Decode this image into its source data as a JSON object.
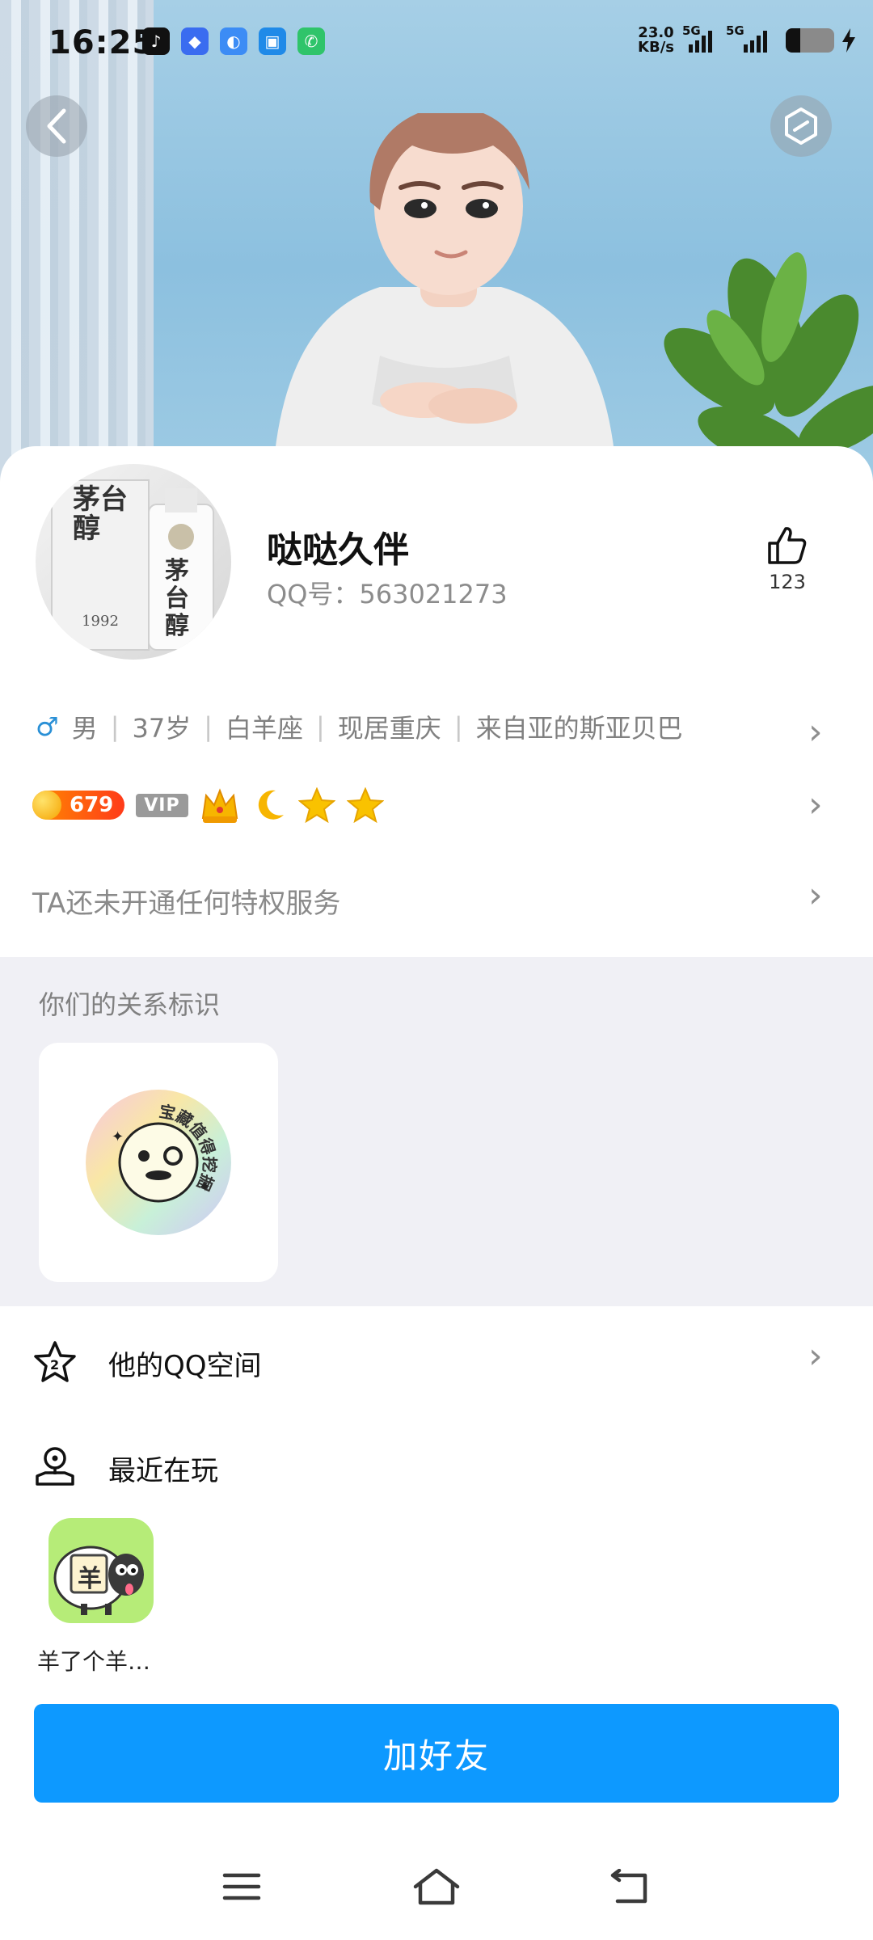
{
  "status_bar": {
    "time": "16:25",
    "net_speed_value": "23.0",
    "net_speed_unit": "KB/s",
    "sim1_label": "5G",
    "sim2_label": "5G",
    "notification_icons": [
      "tiktok-icon",
      "app-icon-blue-diamond",
      "app-icon-blue-oval",
      "app-icon-blue-square",
      "phone-call-icon"
    ]
  },
  "header": {
    "back_icon": "chevron-left-icon",
    "action_icon": "hexagon-settings-icon"
  },
  "profile": {
    "nickname": "哒哒久伴",
    "qq_label": "QQ号：563021273",
    "like_count": "123",
    "avatar_text_1": "茅台醇",
    "avatar_text_2": "茅台醇",
    "avatar_year": "1992"
  },
  "info": {
    "gender": "男",
    "age": "37岁",
    "zodiac": "白羊座",
    "residence": "现居重庆",
    "hometown": "来自亚的斯亚贝巴"
  },
  "badges": {
    "level_number": "679",
    "vip_label": "VIP",
    "level_icons": [
      "crown-icon",
      "moon-icon",
      "star-icon",
      "star-icon"
    ]
  },
  "privilege_text": "TA还未开通任何特权服务",
  "relationship": {
    "title": "你们的关系标识",
    "badge_ring_text": "宝藏值得挖掘"
  },
  "menu": {
    "qzone_label": "他的QQ空间",
    "playing_label": "最近在玩"
  },
  "recent_game": {
    "name": "羊了个羊…",
    "icon_char": "羊"
  },
  "add_friend_button": "加好友",
  "colors": {
    "accent_blue": "#0d99ff",
    "male_blue": "#2a90d6",
    "coin_orange": "#ff5a12",
    "relation_bg": "#f0f0f5"
  }
}
